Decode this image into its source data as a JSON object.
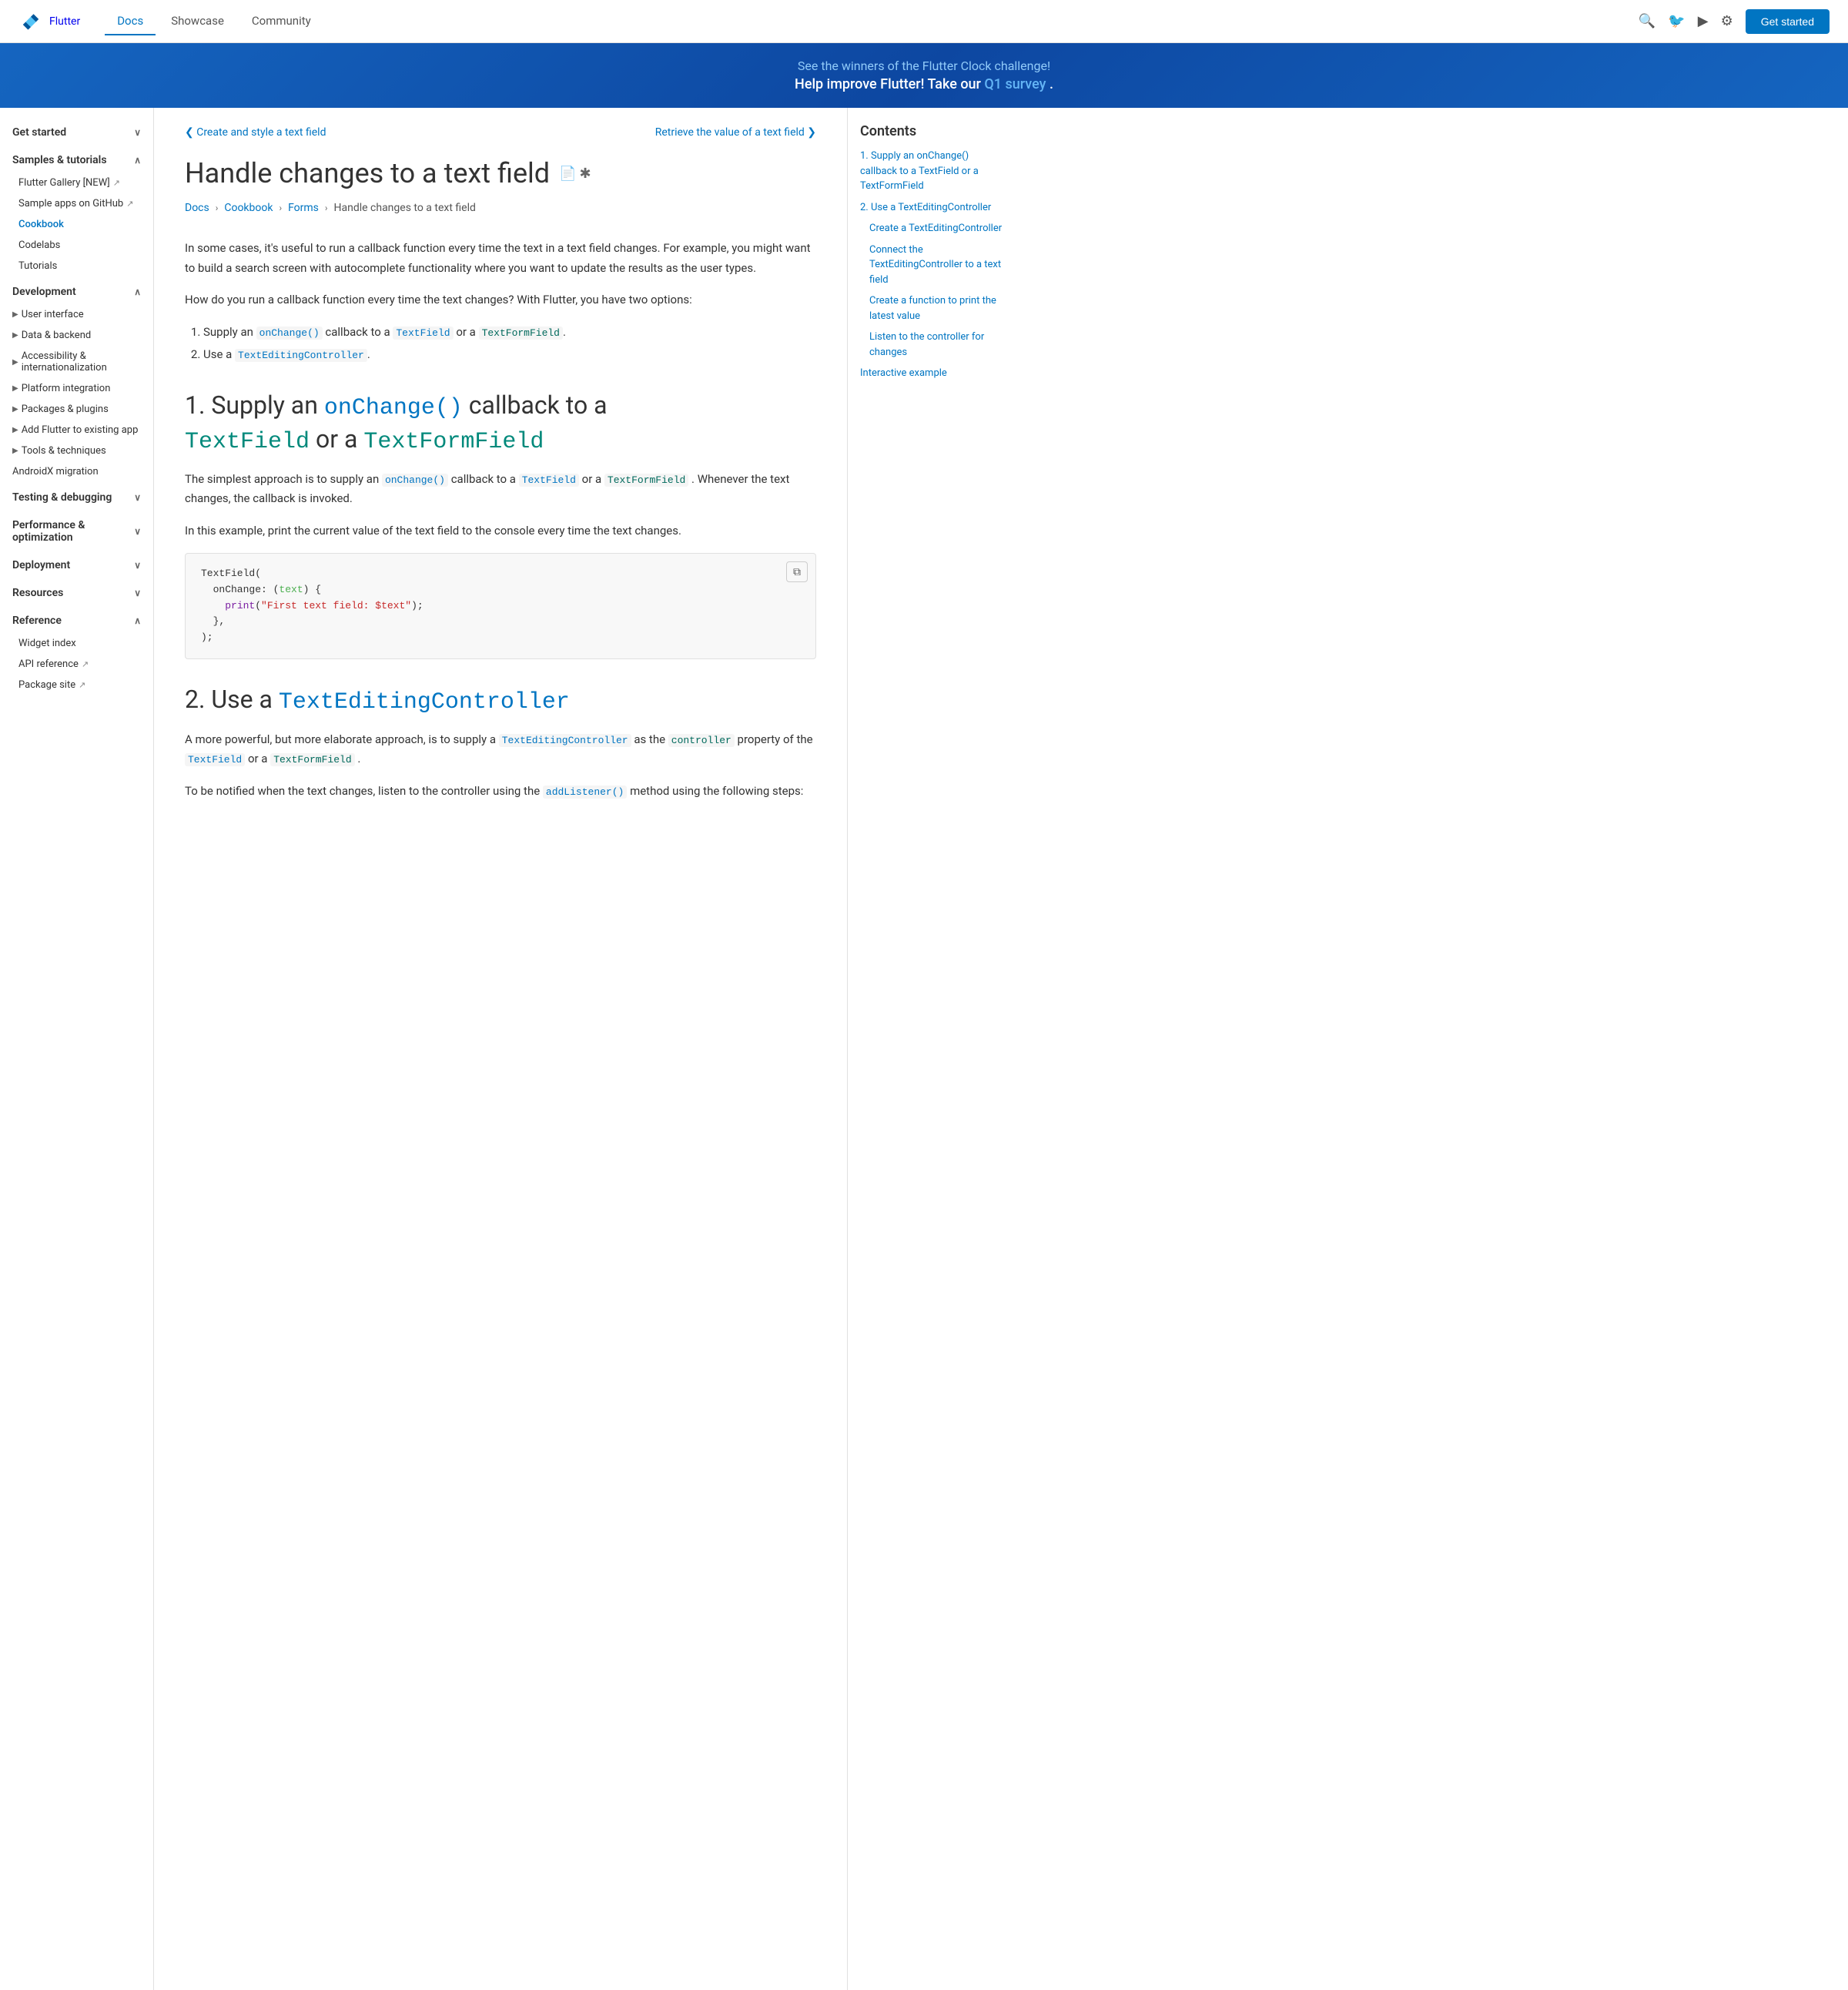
{
  "header": {
    "logo_text": "Flutter",
    "nav": [
      {
        "label": "Docs",
        "active": true
      },
      {
        "label": "Showcase",
        "active": false
      },
      {
        "label": "Community",
        "active": false
      }
    ],
    "get_started": "Get started"
  },
  "banner": {
    "line1": "See the winners of the Flutter Clock challenge!",
    "line2_prefix": "Help improve Flutter! Take our ",
    "line2_link": "Q1 survey",
    "line2_suffix": "."
  },
  "sidebar": {
    "sections": [
      {
        "label": "Get started",
        "expanded": false,
        "items": []
      },
      {
        "label": "Samples & tutorials",
        "expanded": true,
        "items": [
          {
            "label": "Flutter Gallery [NEW]",
            "ext": true
          },
          {
            "label": "Sample apps on GitHub",
            "ext": true
          },
          {
            "label": "Cookbook",
            "active": true
          },
          {
            "label": "Codelabs"
          },
          {
            "label": "Tutorials"
          }
        ]
      },
      {
        "label": "Development",
        "expanded": true,
        "subsections": [
          {
            "label": "User interface"
          },
          {
            "label": "Data & backend"
          },
          {
            "label": "Accessibility & internationalization"
          },
          {
            "label": "Platform integration"
          },
          {
            "label": "Packages & plugins"
          },
          {
            "label": "Add Flutter to existing app"
          },
          {
            "label": "Tools & techniques"
          },
          {
            "label": "AndroidX migration",
            "plain": true
          }
        ]
      },
      {
        "label": "Testing & debugging",
        "expanded": false,
        "items": []
      },
      {
        "label": "Performance & optimization",
        "expanded": false,
        "items": []
      },
      {
        "label": "Deployment",
        "expanded": false,
        "items": []
      },
      {
        "label": "Resources",
        "expanded": false,
        "items": []
      },
      {
        "label": "Reference",
        "expanded": true,
        "items": [
          {
            "label": "Widget index"
          },
          {
            "label": "API reference",
            "ext": true
          },
          {
            "label": "Package site",
            "ext": true
          }
        ]
      }
    ]
  },
  "page": {
    "nav_prev": "❮  Create and style a text field",
    "nav_next": "Retrieve the value of a text field  ❯",
    "title": "Handle changes to a text field",
    "breadcrumb": [
      "Docs",
      "Cookbook",
      "Forms",
      "Handle changes to a text field"
    ],
    "intro": "In some cases, it's useful to run a callback function every time the text in a text field changes. For example, you might want to build a search screen with autocomplete functionality where you want to update the results as the user types.",
    "question": "How do you run a callback function every time the text changes? With Flutter, you have two options:",
    "options": [
      "Supply an onChange() callback to a TextField or a TextFormField.",
      "Use a TextEditingController."
    ],
    "section1_title_prefix": "1. Supply an ",
    "section1_code": "onChange()",
    "section1_title_mid": " callback to a ",
    "section1_code2": "TextField",
    "section1_title_mid2": " or a ",
    "section1_code3": "TextFormField",
    "section1_body1": "The simplest approach is to supply an ",
    "section1_code_inline": "onChange()",
    "section1_body1_mid": " callback to a ",
    "section1_code_tf": "TextField",
    "section1_body1_mid2": " or a ",
    "section1_code_tff": "TextFormField",
    "section1_body1_end": ". Whenever the text changes, the callback is invoked.",
    "section1_body2": "In this example, print the current value of the text field to the console every time the text changes.",
    "code_block": [
      "TextField(",
      "  onChange: (text) {",
      "    print(\"First text field: $text\");",
      "  },",
      ");"
    ],
    "section2_title_prefix": "2. Use a ",
    "section2_code": "TextEditingController",
    "section2_body1": "A more powerful, but more elaborate approach, is to supply a ",
    "section2_code1": "TextEditingController",
    "section2_body1_mid": " as the ",
    "section2_code2": "controller",
    "section2_body1_mid2": " property of the ",
    "section2_code3": "TextField",
    "section2_body1_mid3": " or a ",
    "section2_code4": "TextFormField",
    "section2_body1_end": ".",
    "section2_body2_prefix": "To be notified when the text changes, listen to the controller using the ",
    "section2_code5": "addListener()",
    "section2_body2_end": " method using the following steps:"
  },
  "contents": {
    "title": "Contents",
    "items": [
      {
        "label": "1. Supply an onChange() callback to a TextField or a TextFormField",
        "sub": false
      },
      {
        "label": "2. Use a TextEditingController",
        "sub": false
      },
      {
        "label": "Create a TextEditingController",
        "sub": true
      },
      {
        "label": "Connect the TextEditingController to a text field",
        "sub": true
      },
      {
        "label": "Create a function to print the latest value",
        "sub": true
      },
      {
        "label": "Listen to the controller for changes",
        "sub": true
      },
      {
        "label": "Interactive example",
        "sub": false
      }
    ]
  }
}
